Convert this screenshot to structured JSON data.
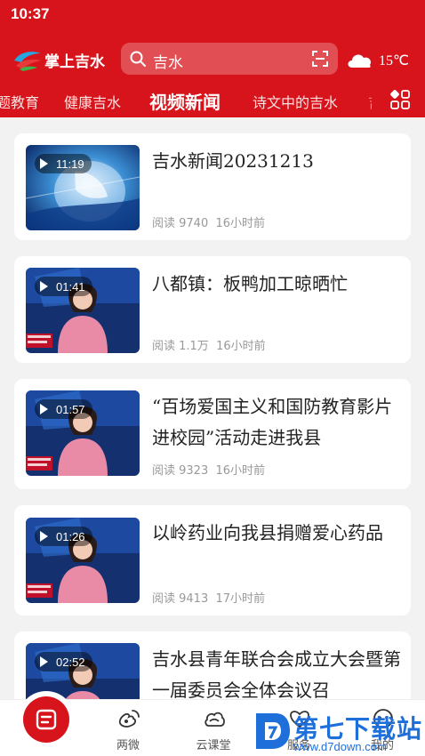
{
  "status_bar": {
    "time": "10:37"
  },
  "header": {
    "logo_text": "掌上吉水",
    "search_text": "吉水",
    "temperature": "15℃"
  },
  "tabs": [
    {
      "label": "题教育",
      "active": false
    },
    {
      "label": "健康吉水",
      "active": false
    },
    {
      "label": "视频新闻",
      "active": true
    },
    {
      "label": "诗文中的吉水",
      "active": false
    },
    {
      "label": "吉",
      "active": false
    }
  ],
  "feed": [
    {
      "title": "吉水新闻20231213",
      "duration": "11:19",
      "reads": "阅读 9740",
      "time": "16小时前",
      "thumb": "globe"
    },
    {
      "title": "八都镇：板鸭加工晾晒忙",
      "duration": "01:41",
      "reads": "阅读 1.1万",
      "time": "16小时前",
      "thumb": "anchor"
    },
    {
      "title": "“百场爱国主义和国防教育影片进校园”活动走进我县",
      "duration": "01:57",
      "reads": "阅读 9323",
      "time": "16小时前",
      "thumb": "anchor"
    },
    {
      "title": "以岭药业向我县捐赠爱心药品",
      "duration": "01:26",
      "reads": "阅读 9413",
      "time": "17小时前",
      "thumb": "anchor"
    },
    {
      "title": "吉水县青年联合会成立大会暨第一届委员会全体会议召",
      "duration": "02:52",
      "reads": "",
      "time": "",
      "thumb": "anchor"
    }
  ],
  "bottom_nav": [
    {
      "label": "",
      "icon": "home-news-icon"
    },
    {
      "label": "两微",
      "icon": "weibo-icon"
    },
    {
      "label": "云课堂",
      "icon": "cloud-icon"
    },
    {
      "label": "服务",
      "icon": "heart-icon"
    },
    {
      "label": "我的",
      "icon": "user-icon"
    }
  ],
  "watermark": {
    "brand": "第七下载站",
    "url": "www.d7down.com"
  },
  "colors": {
    "brand_red": "#d7141b",
    "watermark_blue": "#1e6fd9"
  }
}
